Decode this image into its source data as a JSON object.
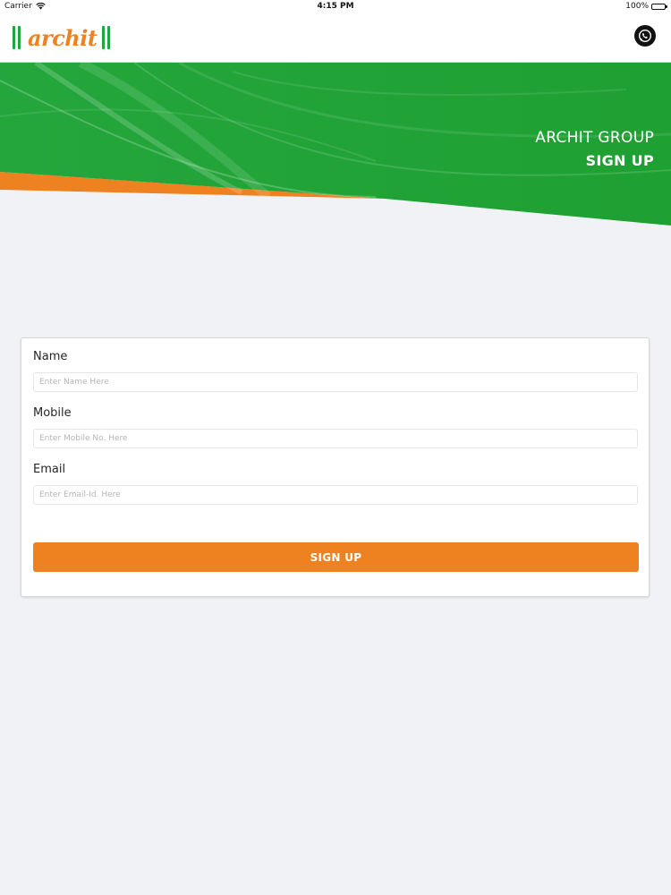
{
  "status_bar": {
    "carrier": "Carrier",
    "time": "4:15 PM",
    "battery": "100%",
    "battery_level": 1.0
  },
  "header": {
    "logo_text": "archit",
    "call_icon": "whatsapp-call-icon"
  },
  "banner": {
    "title": "ARCHIT GROUP",
    "subtitle": "SIGN UP",
    "colors": {
      "green": "#22a23a",
      "orange": "#ee8120"
    }
  },
  "form": {
    "name_label": "Name",
    "name_placeholder": "Enter Name Here",
    "name_value": "",
    "mobile_label": "Mobile",
    "mobile_placeholder": "Enter Mobile No. Here",
    "mobile_value": "",
    "email_label": "Email",
    "email_placeholder": "Enter Email-Id. Here",
    "email_value": "",
    "submit_label": "SIGN UP"
  },
  "colors": {
    "accent": "#ee8120",
    "brand_green": "#20a540",
    "background": "#f1f2f6"
  }
}
